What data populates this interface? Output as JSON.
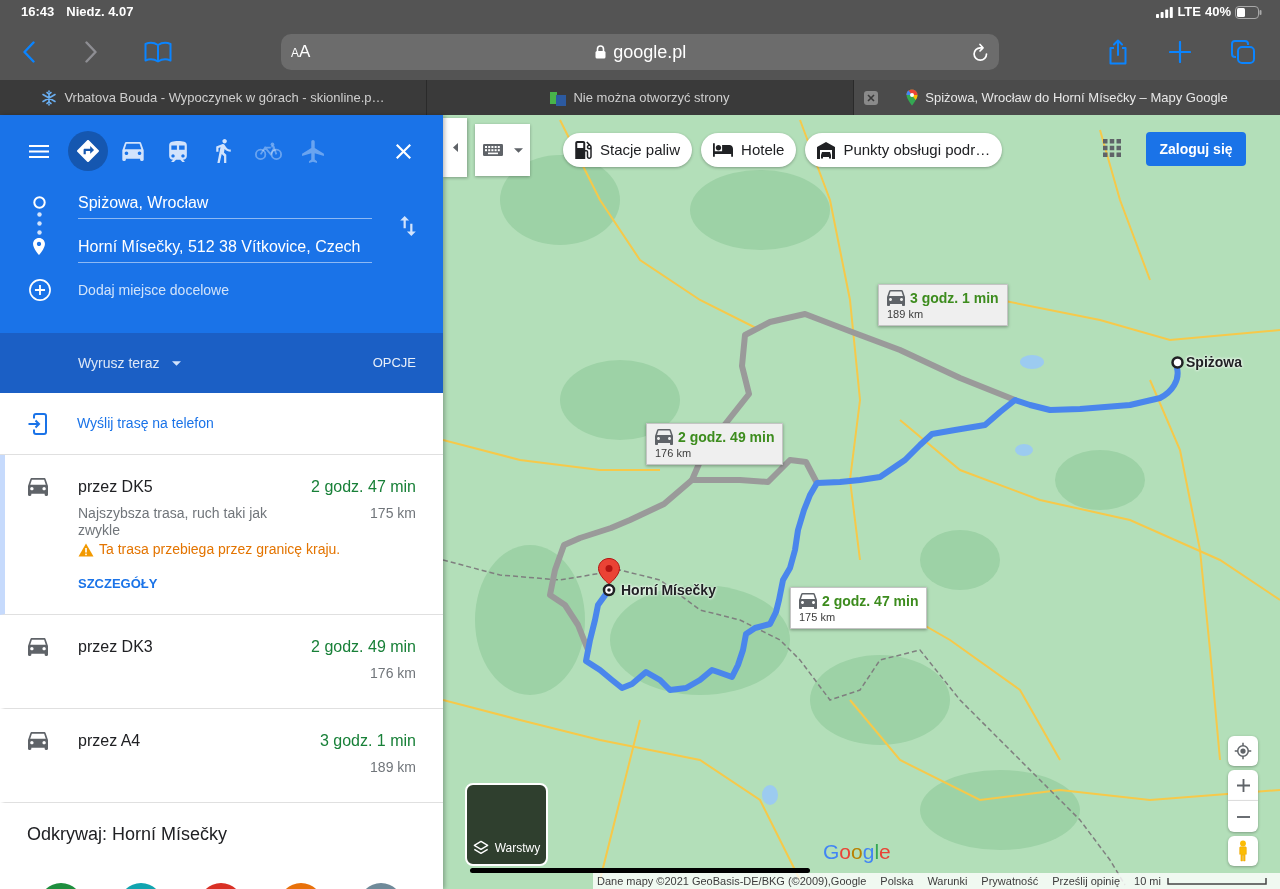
{
  "status_bar": {
    "time": "16:43",
    "date": "Niedz. 4.07",
    "network": "LTE",
    "battery": "40%"
  },
  "browser": {
    "nav_buttons": [
      {
        "kind": "back",
        "disabled": false
      },
      {
        "kind": "forward",
        "disabled": true
      }
    ],
    "reader_button": "AA",
    "address": "google.pl",
    "tabs": [
      {
        "kind": "snowflake",
        "title": "Vrbatova Bouda - Wypoczynek w górach - skionline.p…",
        "selected": false
      },
      {
        "kind": "page",
        "title": "Nie można otworzyć strony",
        "selected": false
      },
      {
        "kind": "maps",
        "title": "Spiżowa, Wrocław do Horní Mísečky – Mapy Google",
        "selected": true
      }
    ]
  },
  "directions_panel": {
    "travel_modes": [
      {
        "kind": "best",
        "selected": true,
        "disabled": false
      },
      {
        "kind": "car",
        "selected": false,
        "disabled": false
      },
      {
        "kind": "transit",
        "selected": false,
        "disabled": false
      },
      {
        "kind": "walk",
        "selected": false,
        "disabled": false
      },
      {
        "kind": "bike",
        "selected": false,
        "disabled": true
      },
      {
        "kind": "plane",
        "selected": false,
        "disabled": true
      }
    ],
    "origin": "Spiżowa, Wrocław",
    "destination": "Horní Mísečky, 512 38 Vítkovice, Czech",
    "add_destination": "Dodaj miejsce docelowe",
    "depart": "Wyrusz teraz",
    "options": "OPCJE",
    "send_to_phone": "Wyślij trasę na telefon",
    "routes": [
      {
        "name": "przez DK5",
        "duration": "2 godz. 47 min",
        "distance": "175 km",
        "description": "Najszybsza trasa, ruch taki jak zwykle",
        "warning": "Ta trasa przebiega przez granicę kraju.",
        "details": "SZCZEGÓŁY",
        "selected": true
      },
      {
        "name": "przez DK3",
        "duration": "2 godz. 49 min",
        "distance": "176 km",
        "selected": false
      },
      {
        "name": "przez A4",
        "duration": "3 godz. 1 min",
        "distance": "189 km",
        "selected": false
      }
    ],
    "explore": {
      "title": "Odkrywaj: Horní Mísečky",
      "categories": [
        {
          "color": "#1e8e3e"
        },
        {
          "color": "#12a4af"
        },
        {
          "color": "#d93025"
        },
        {
          "color": "#e8710a"
        },
        {
          "color": "#6f8a99"
        }
      ]
    }
  },
  "map": {
    "chips": [
      {
        "kind": "fuel",
        "label": "Stacje paliw"
      },
      {
        "kind": "hotel",
        "label": "Hotele"
      },
      {
        "kind": "service",
        "label": "Punkty obsługi podr…"
      }
    ],
    "sign_in": "Zaloguj się",
    "route_callouts": [
      {
        "duration": "3 godz. 1 min",
        "distance": "189 km",
        "selected": false
      },
      {
        "duration": "2 godz. 49 min",
        "distance": "176 km",
        "selected": false
      },
      {
        "duration": "2 godz. 47 min",
        "distance": "175 km",
        "selected": true
      }
    ],
    "endpoints": [
      {
        "kind": "origin",
        "label": "Spiżowa"
      },
      {
        "kind": "destination",
        "label": "Horní Mísečky"
      }
    ],
    "layers_label": "Warstwy",
    "logo": "Google",
    "footer": {
      "attribution": "Dane mapy ©2021 GeoBasis-DE/BKG (©2009),Google",
      "links": [
        "Polska",
        "Warunki",
        "Prywatność",
        "Prześlij opinię"
      ],
      "scale": "10 mi"
    }
  }
}
